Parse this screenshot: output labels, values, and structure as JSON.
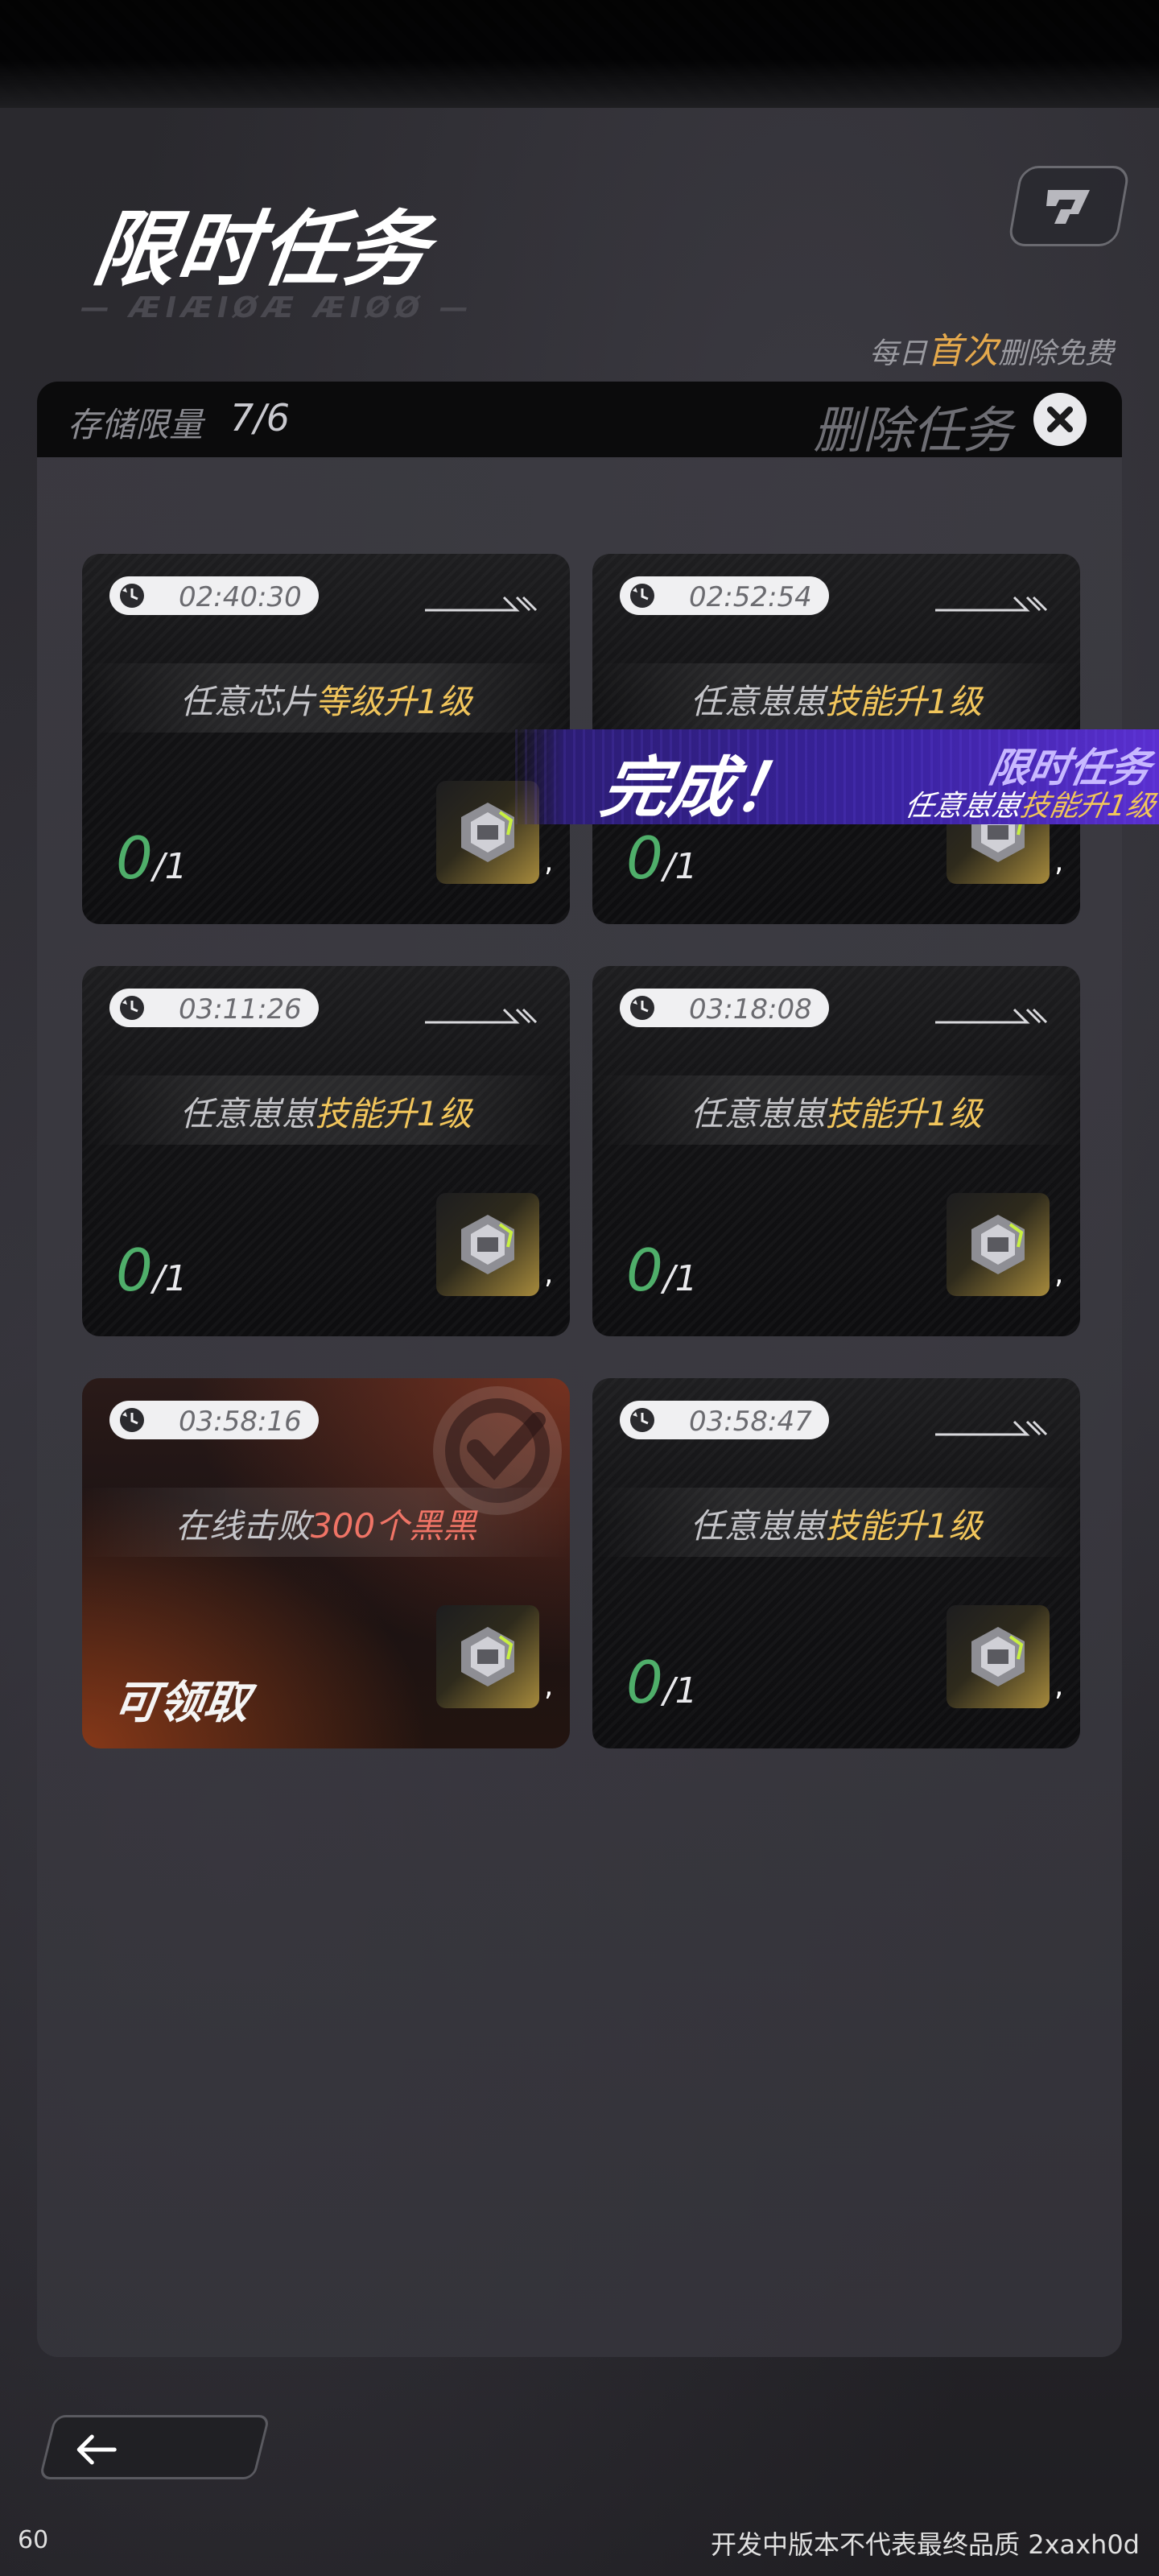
{
  "header": {
    "title": "限时任务",
    "subtitle_en": "— ÆIÆIØÆ ÆIØØ —",
    "corner_icon": "logo-icon"
  },
  "delete_note": {
    "prefix": "每日",
    "highlight": "首次",
    "suffix": "删除免费"
  },
  "storage": {
    "label": "存储限量",
    "count": "7/6",
    "delete_label": "删除任务",
    "delete_icon": "close-icon"
  },
  "cards": [
    {
      "timer": "02:40:30",
      "task_prefix": "任意芯片",
      "task_highlight": "等级升1级",
      "progress_current": "0",
      "progress_total": "/1",
      "reward_comma": ",",
      "status": "in_progress"
    },
    {
      "timer": "02:52:54",
      "task_prefix": "任意崽崽",
      "task_highlight": "技能升1级",
      "progress_current": "0",
      "progress_total": "/1",
      "reward_comma": ",",
      "status": "in_progress"
    },
    {
      "timer": "03:11:26",
      "task_prefix": "任意崽崽",
      "task_highlight": "技能升1级",
      "progress_current": "0",
      "progress_total": "/1",
      "reward_comma": ",",
      "status": "in_progress"
    },
    {
      "timer": "03:18:08",
      "task_prefix": "任意崽崽",
      "task_highlight": "技能升1级",
      "progress_current": "0",
      "progress_total": "/1",
      "reward_comma": ",",
      "status": "in_progress"
    },
    {
      "timer": "03:58:16",
      "task_prefix": "在线击败",
      "task_highlight": "300个黑黑",
      "claim_label": "可领取",
      "reward_comma": ",",
      "status": "claimable"
    },
    {
      "timer": "03:58:47",
      "task_prefix": "任意崽崽",
      "task_highlight": "技能升1级",
      "progress_current": "0",
      "progress_total": "/1",
      "reward_comma": ",",
      "status": "in_progress"
    }
  ],
  "completion_banner": {
    "done_label": "完成！",
    "title": "限时任务",
    "sub_prefix": "任意崽崽",
    "sub_highlight": "技能升1级"
  },
  "footer": {
    "back_icon": "arrow-left-icon",
    "fps": "60",
    "watermark": "开发中版本不代表最终品质 2xaxh0d"
  },
  "colors": {
    "accent_gold": "#f1c55b",
    "progress_green": "#4fae6a",
    "highlight_red": "#f07466",
    "banner_purple": "#3a23a0"
  }
}
